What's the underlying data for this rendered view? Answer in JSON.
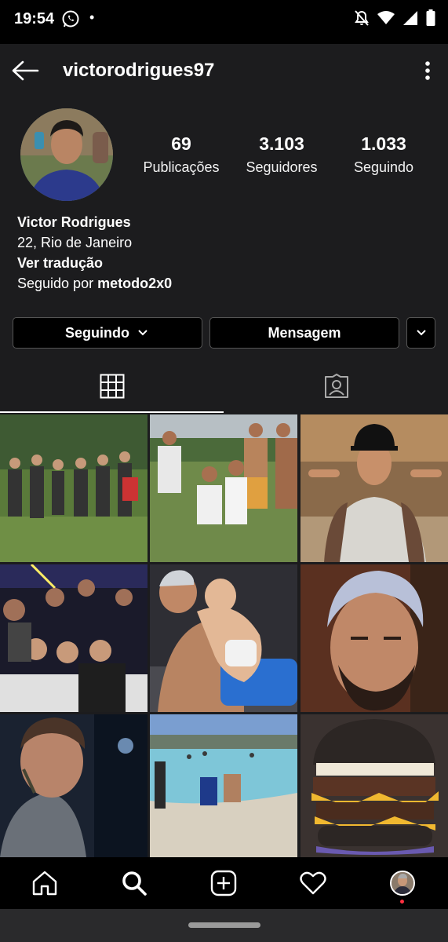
{
  "status_bar": {
    "time": "19:54",
    "dot": "•"
  },
  "header": {
    "username": "victorodrigues97"
  },
  "stats": [
    {
      "value": "69",
      "label": "Publicações"
    },
    {
      "value": "3.103",
      "label": "Seguidores"
    },
    {
      "value": "1.033",
      "label": "Seguindo"
    }
  ],
  "bio": {
    "name": "Victor Rodrigues",
    "line": "22, Rio de Janeiro",
    "translate": "Ver tradução",
    "followed_by_prefix": "Seguido por ",
    "followed_by_user": "metodo2x0"
  },
  "actions": {
    "following": "Seguindo",
    "message": "Mensagem"
  },
  "tabs": [
    "grid-icon",
    "tagged-icon"
  ],
  "posts": [
    "group-photo-outdoors",
    "group-photo-beach",
    "man-cap-pointing",
    "party-group",
    "man-with-baby",
    "man-closeup-beard",
    "man-smiling-profile",
    "beach-shore",
    "burger"
  ],
  "bottom_nav": [
    "home-icon",
    "search-icon",
    "add-icon",
    "heart-icon",
    "profile-avatar"
  ],
  "colors": {
    "background": "#1c1c1e",
    "button_bg": "#000000",
    "notification_dot": "#ff3040"
  }
}
